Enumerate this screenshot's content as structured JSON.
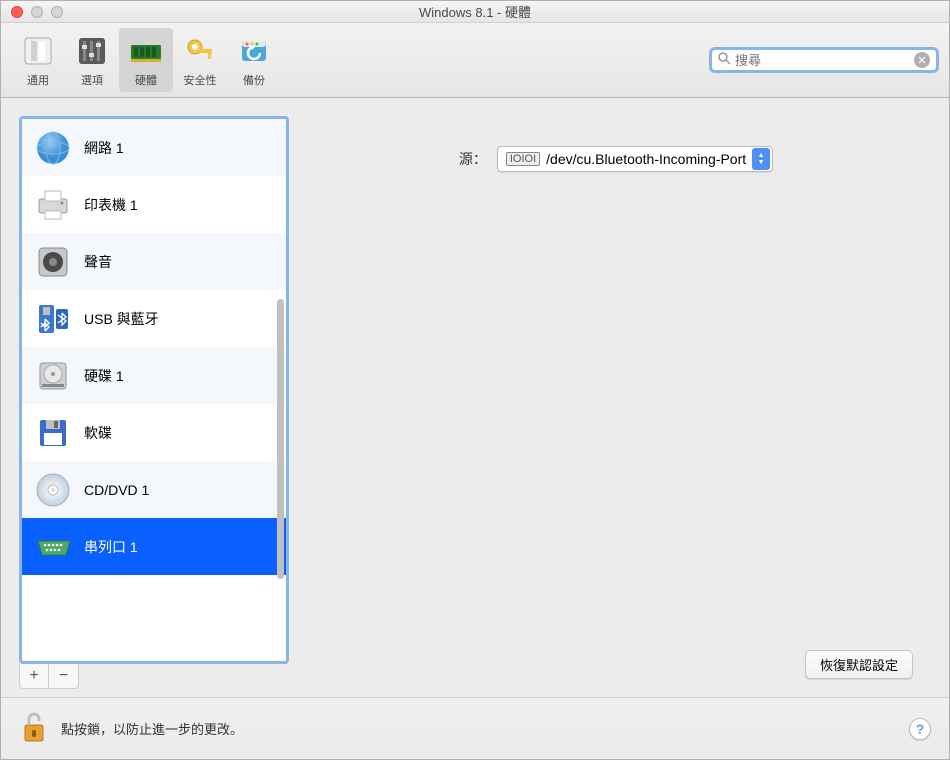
{
  "window": {
    "title": "Windows 8.1 - 硬體"
  },
  "toolbar": {
    "items": [
      {
        "id": "general",
        "label": "通用"
      },
      {
        "id": "options",
        "label": "選項"
      },
      {
        "id": "hardware",
        "label": "硬體"
      },
      {
        "id": "security",
        "label": "安全性"
      },
      {
        "id": "backup",
        "label": "備份"
      }
    ],
    "selected": "hardware",
    "search_placeholder": "搜尋"
  },
  "sidebar": {
    "items": [
      {
        "id": "network",
        "label": "網路 1"
      },
      {
        "id": "printer",
        "label": "印表機 1"
      },
      {
        "id": "sound",
        "label": "聲音"
      },
      {
        "id": "usb-bt",
        "label": "USB 與藍牙"
      },
      {
        "id": "hdd",
        "label": "硬碟 1"
      },
      {
        "id": "floppy",
        "label": "軟碟"
      },
      {
        "id": "cddvd",
        "label": "CD/DVD 1"
      },
      {
        "id": "serial",
        "label": "串列口 1"
      }
    ],
    "selected": "serial",
    "add_label": "+",
    "remove_label": "−"
  },
  "detail": {
    "source_label": "源：",
    "source_value": "/dev/cu.Bluetooth-Incoming-Port"
  },
  "buttons": {
    "restore_defaults": "恢復默認設定"
  },
  "footer": {
    "lock_text": "點按鎖，以防止進一步的更改。",
    "help": "?"
  }
}
